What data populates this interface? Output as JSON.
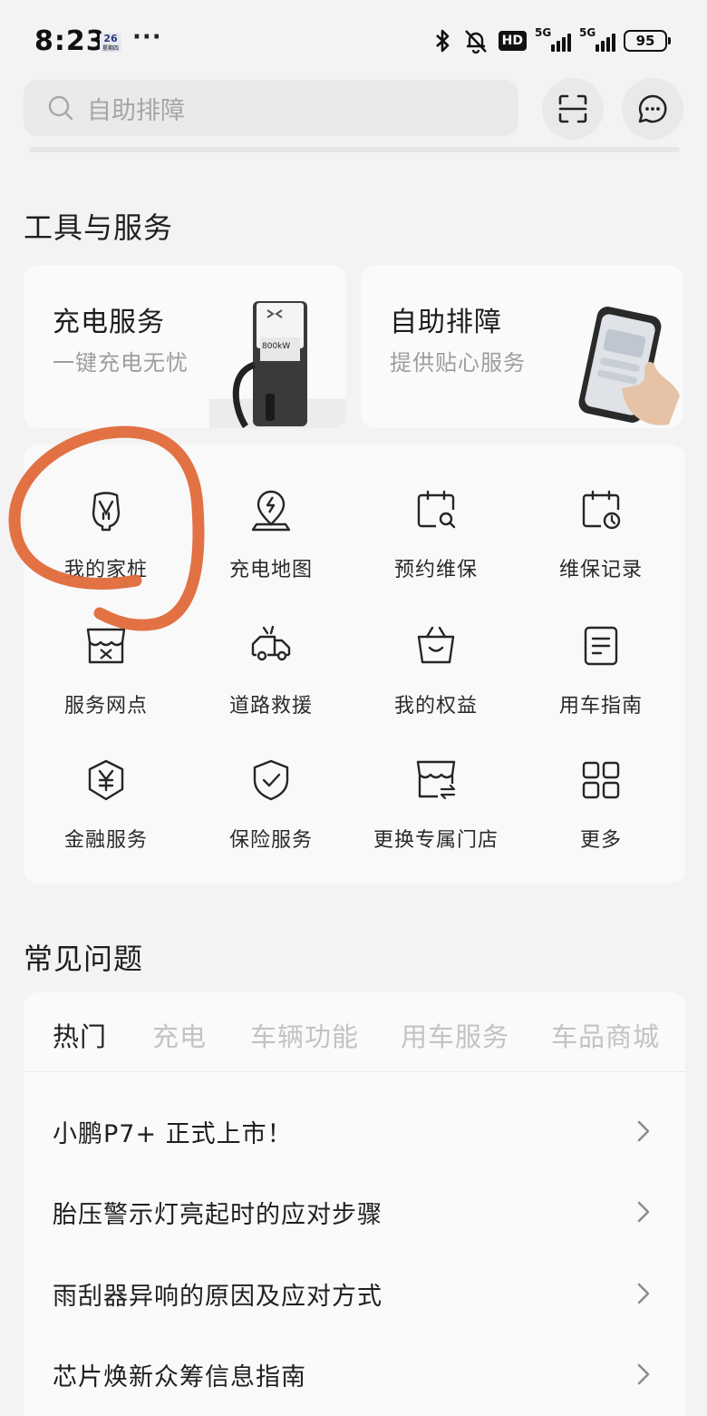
{
  "status_bar": {
    "time": "8:23",
    "badge_day": "26",
    "badge_sub": "星期四",
    "more": "···",
    "hd_label": "HD",
    "network_1": "5G",
    "network_2": "5G",
    "battery": "95"
  },
  "search": {
    "placeholder": "自助排障",
    "scan_icon": "scan-icon",
    "message_icon": "message-icon"
  },
  "tools_section": {
    "title": "工具与服务",
    "cards": [
      {
        "title": "充电服务",
        "subtitle": "一键充电无忧",
        "image": "charger-image",
        "charger_screen": "800kW"
      },
      {
        "title": "自助排障",
        "subtitle": "提供贴心服务",
        "image": "phone-in-hand-image"
      }
    ],
    "grid": [
      {
        "label": "我的家桩",
        "icon": "home-charger-icon"
      },
      {
        "label": "充电地图",
        "icon": "charge-map-icon"
      },
      {
        "label": "预约维保",
        "icon": "calendar-search-icon"
      },
      {
        "label": "维保记录",
        "icon": "calendar-clock-icon"
      },
      {
        "label": "服务网点",
        "icon": "service-store-icon"
      },
      {
        "label": "道路救援",
        "icon": "tow-truck-icon"
      },
      {
        "label": "我的权益",
        "icon": "benefits-basket-icon"
      },
      {
        "label": "用车指南",
        "icon": "guide-document-icon"
      },
      {
        "label": "金融服务",
        "icon": "yuan-shield-icon"
      },
      {
        "label": "保险服务",
        "icon": "check-shield-icon"
      },
      {
        "label": "更换专属门店",
        "icon": "switch-store-icon"
      },
      {
        "label": "更多",
        "icon": "more-grid-icon"
      }
    ]
  },
  "annotation": {
    "color": "#e0693a",
    "target": "我的家桩"
  },
  "faq_section": {
    "title": "常见问题",
    "tabs": [
      "热门",
      "充电",
      "车辆功能",
      "用车服务",
      "车品商城"
    ],
    "active_tab": 0,
    "questions": [
      "小鹏P7+ 正式上市！",
      "胎压警示灯亮起时的应对步骤",
      "雨刮器异响的原因及应对方式",
      "芯片焕新众筹信息指南"
    ]
  },
  "colors": {
    "background": "#f3f3f3",
    "card": "#fafafa",
    "text": "#1c1c1c",
    "muted": "#9d9d9d",
    "tab_inactive": "#c3c3c3"
  }
}
